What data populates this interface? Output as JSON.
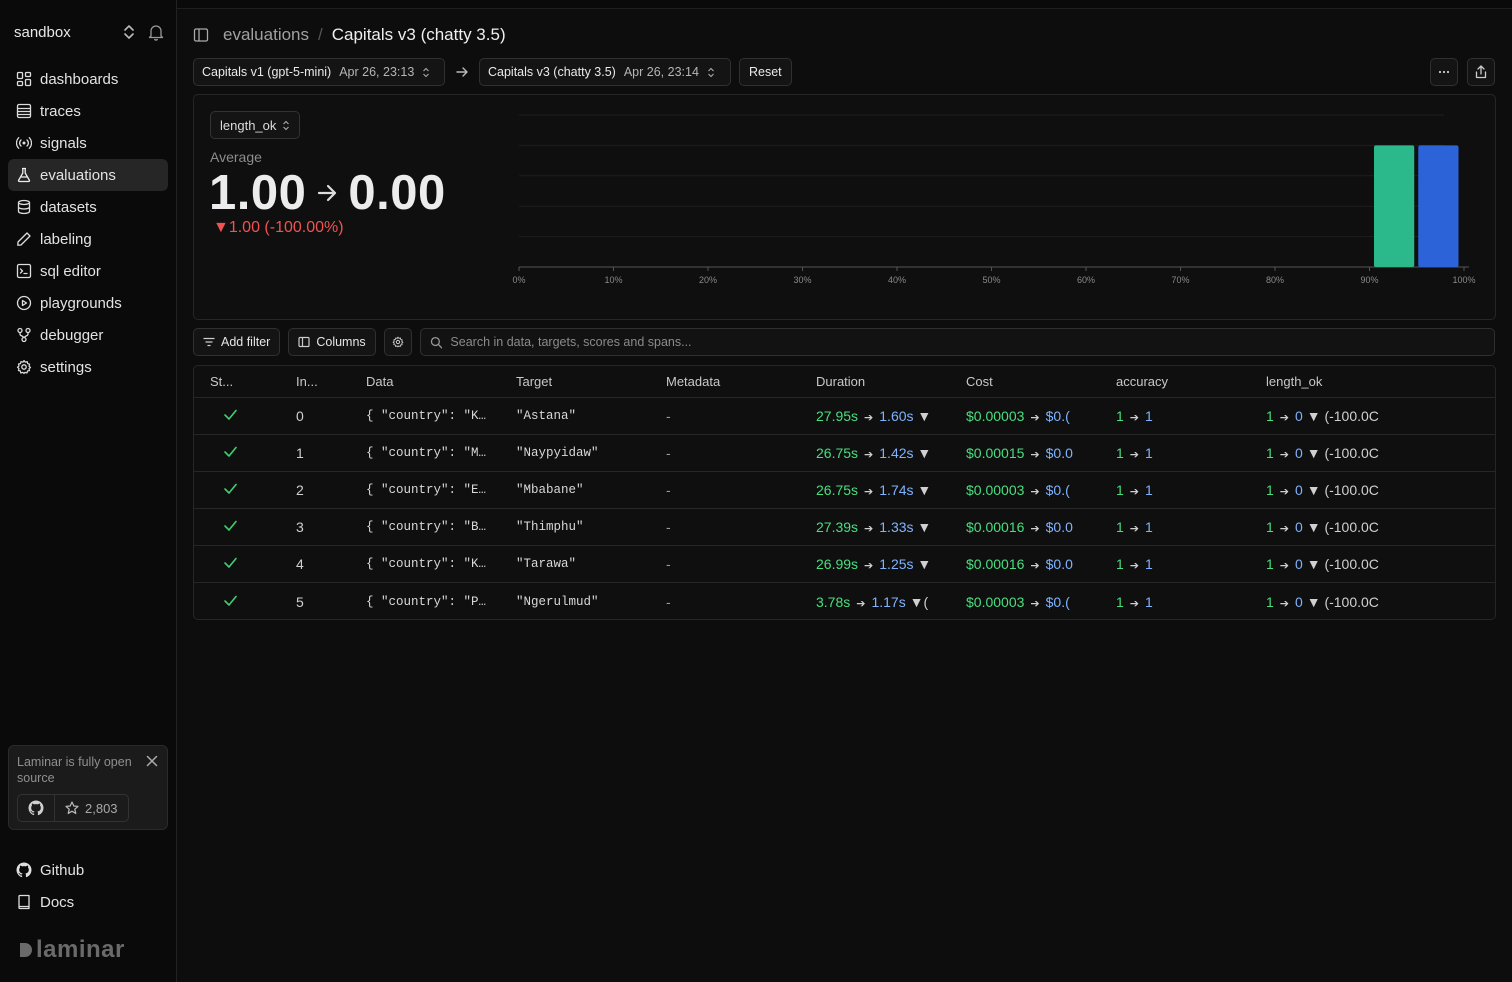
{
  "workspace": {
    "name": "sandbox"
  },
  "nav": [
    {
      "label": "dashboards",
      "icon": "dashboard-icon"
    },
    {
      "label": "traces",
      "icon": "table-icon"
    },
    {
      "label": "signals",
      "icon": "broadcast-icon"
    },
    {
      "label": "evaluations",
      "icon": "flask-icon",
      "active": true
    },
    {
      "label": "datasets",
      "icon": "database-icon"
    },
    {
      "label": "labeling",
      "icon": "pen-icon"
    },
    {
      "label": "sql editor",
      "icon": "terminal-icon"
    },
    {
      "label": "playgrounds",
      "icon": "play-circle-icon"
    },
    {
      "label": "debugger",
      "icon": "workflow-icon"
    },
    {
      "label": "settings",
      "icon": "gear-icon"
    }
  ],
  "oss_card": {
    "text": "Laminar is fully open source",
    "stars": "2,803"
  },
  "bottom_links": [
    {
      "label": "Github",
      "icon": "github-icon"
    },
    {
      "label": "Docs",
      "icon": "book-icon"
    }
  ],
  "logo": {
    "text": "laminar"
  },
  "breadcrumb": {
    "section": "evaluations",
    "separator": "/",
    "page": "Capitals v3 (chatty 3.5)"
  },
  "compare": {
    "left": {
      "name": "Capitals v1 (gpt-5-mini)",
      "date": "Apr 26, 23:13"
    },
    "right": {
      "name": "Capitals v3 (chatty 3.5)",
      "date": "Apr 26, 23:14"
    },
    "reset_label": "Reset"
  },
  "score_panel": {
    "score_name": "length_ok",
    "label": "Average",
    "from": "1.00",
    "to": "0.00",
    "delta": "▼1.00 (-100.00%)"
  },
  "chart_data": {
    "type": "bar",
    "x_ticks": [
      "0%",
      "10%",
      "20%",
      "30%",
      "40%",
      "50%",
      "60%",
      "70%",
      "80%",
      "90%",
      "100%"
    ],
    "series": [
      {
        "bin": "90%-100%",
        "value": 1,
        "color": "#2bb88a"
      },
      {
        "bin": "90%-100%",
        "value": 1,
        "color": "#2c63d9"
      }
    ],
    "ylim": [
      0,
      1.25
    ],
    "grid": true
  },
  "filters": {
    "add_filter_label": "Add filter",
    "columns_label": "Columns",
    "search_placeholder": "Search in data, targets, scores and spans..."
  },
  "table": {
    "columns": [
      "St...",
      "In...",
      "Data",
      "Target",
      "Metadata",
      "Duration",
      "Cost",
      "accuracy",
      "length_ok"
    ],
    "rows": [
      {
        "index": "0",
        "data": "{ \"country\": \"K…",
        "target": "\"Astana\"",
        "meta": "-",
        "dur_a": "27.95s",
        "dur_b": "1.60s",
        "dur_tail": "▼",
        "cost_a": "$0.00003",
        "cost_b": "$0.(",
        "acc_a": "1",
        "acc_b": "1",
        "len_a": "1",
        "len_b": "0",
        "len_tail": "▼ (-100.0C"
      },
      {
        "index": "1",
        "data": "{ \"country\": \"M…",
        "target": "\"Naypyidaw\"",
        "meta": "-",
        "dur_a": "26.75s",
        "dur_b": "1.42s",
        "dur_tail": "▼",
        "cost_a": "$0.00015",
        "cost_b": "$0.0",
        "acc_a": "1",
        "acc_b": "1",
        "len_a": "1",
        "len_b": "0",
        "len_tail": "▼ (-100.0C"
      },
      {
        "index": "2",
        "data": "{ \"country\": \"E…",
        "target": "\"Mbabane\"",
        "meta": "-",
        "dur_a": "26.75s",
        "dur_b": "1.74s",
        "dur_tail": "▼",
        "cost_a": "$0.00003",
        "cost_b": "$0.(",
        "acc_a": "1",
        "acc_b": "1",
        "len_a": "1",
        "len_b": "0",
        "len_tail": "▼ (-100.0C"
      },
      {
        "index": "3",
        "data": "{ \"country\": \"B…",
        "target": "\"Thimphu\"",
        "meta": "-",
        "dur_a": "27.39s",
        "dur_b": "1.33s",
        "dur_tail": "▼",
        "cost_a": "$0.00016",
        "cost_b": "$0.0",
        "acc_a": "1",
        "acc_b": "1",
        "len_a": "1",
        "len_b": "0",
        "len_tail": "▼ (-100.0C"
      },
      {
        "index": "4",
        "data": "{ \"country\": \"K…",
        "target": "\"Tarawa\"",
        "meta": "-",
        "dur_a": "26.99s",
        "dur_b": "1.25s",
        "dur_tail": "▼",
        "cost_a": "$0.00016",
        "cost_b": "$0.0",
        "acc_a": "1",
        "acc_b": "1",
        "len_a": "1",
        "len_b": "0",
        "len_tail": "▼ (-100.0C"
      },
      {
        "index": "5",
        "data": "{ \"country\": \"P…",
        "target": "\"Ngerulmud\"",
        "meta": "-",
        "dur_a": "3.78s",
        "dur_b": "1.17s",
        "dur_tail": "▼(",
        "cost_a": "$0.00003",
        "cost_b": "$0.(",
        "acc_a": "1",
        "acc_b": "1",
        "len_a": "1",
        "len_b": "0",
        "len_tail": "▼ (-100.0C"
      }
    ]
  }
}
